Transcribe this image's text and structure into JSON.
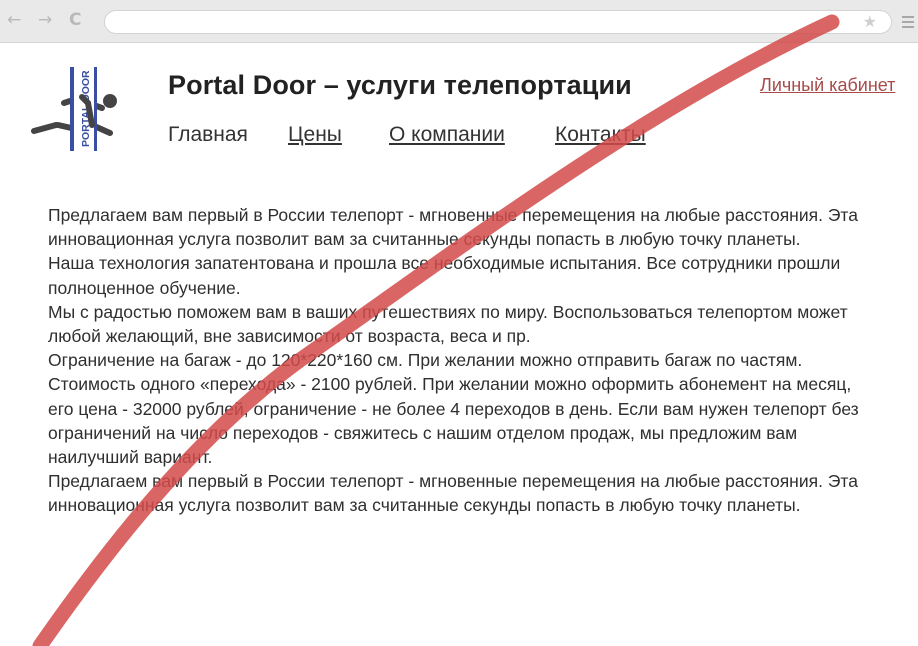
{
  "browser": {
    "back_glyph": "←",
    "forward_glyph": "→",
    "reload_glyph": "C",
    "star_glyph": "★"
  },
  "site": {
    "title": "Portal Door – услуги телепортации",
    "logo_text": "PORTAL DOOR",
    "account_link": "Личный кабинет"
  },
  "nav": {
    "items": [
      {
        "label": "Главная"
      },
      {
        "label": "Цены"
      },
      {
        "label": "О компании"
      },
      {
        "label": "Контакты"
      }
    ]
  },
  "content": {
    "paragraphs": [
      "Предлагаем вам первый в России телепорт - мгновенные перемещения на любые расстояния. Эта инновационная услуга позволит вам за считанные секунды попасть в любую точку планеты.",
      "Наша технология запатентована и прошла все необходимые испытания. Все сотрудники прошли полноценное обучение.",
      "Мы с радостью поможем вам в ваших путешествиях по миру. Воспользоваться телепортом может любой желающий, вне зависимости от возраста, веса и пр.",
      "Ограничение на багаж - до 120*220*160 см. При желании можно отправить багаж по частям.",
      "Стоимость одного «перехода» - 2100 рублей. При желании можно оформить абонемент на месяц, его цена - 32000 рублей, ограничение - не более 4 переходов в день. Если вам нужен телепорт без ограничений на число переходов - свяжитесь с нашим отделом продаж, мы предложим вам наилучший вариант.",
      "Предлагаем вам первый в России телепорт - мгновенные перемещения на любые расстояния. Эта инновационная услуга позволит вам за считанные секунды попасть в любую точку планеты."
    ]
  },
  "colors": {
    "link_red": "#a84a4a",
    "slash_red": "#d44a4a",
    "logo_blue": "#3a4fa3"
  }
}
